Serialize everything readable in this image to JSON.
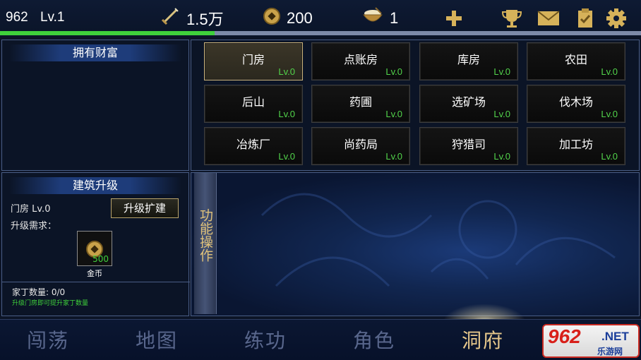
{
  "player": {
    "id": "962",
    "level": "Lv.1",
    "exp_progress": 0.335
  },
  "resources": {
    "power": "1.5万",
    "coins": "200",
    "food": "1"
  },
  "top_icons": [
    "plus-icon",
    "trophy-icon",
    "mail-icon",
    "clipboard-icon",
    "gear-icon"
  ],
  "wealth_panel": {
    "title": "拥有财富"
  },
  "buildings": [
    {
      "name": "门房",
      "level": "Lv.0",
      "selected": true
    },
    {
      "name": "点账房",
      "level": "Lv.0"
    },
    {
      "name": "库房",
      "level": "Lv.0"
    },
    {
      "name": "农田",
      "level": "Lv.0"
    },
    {
      "name": "后山",
      "level": "Lv.0"
    },
    {
      "name": "药圃",
      "level": "Lv.0"
    },
    {
      "name": "选矿场",
      "level": "Lv.0"
    },
    {
      "name": "伐木场",
      "level": "Lv.0"
    },
    {
      "name": "冶炼厂",
      "level": "Lv.0"
    },
    {
      "name": "尚药局",
      "level": "Lv.0"
    },
    {
      "name": "狩猎司",
      "level": "Lv.0"
    },
    {
      "name": "加工坊",
      "level": "Lv.0"
    }
  ],
  "upgrade_panel": {
    "title": "建筑升级",
    "current": "门房 Lv.0",
    "button": "升级扩建",
    "requirement_label": "升级需求：",
    "requirement_item": {
      "name": "金币",
      "qty": "500"
    },
    "family_count": "家丁数量: 0/0",
    "family_hint": "升级门房即可提升家丁数量"
  },
  "function_panel": {
    "tab_label": "功能操作"
  },
  "bottom_nav": [
    {
      "label": "闯荡",
      "active": false
    },
    {
      "label": "地图",
      "active": false
    },
    {
      "label": "练功",
      "active": false
    },
    {
      "label": "角色",
      "active": false
    },
    {
      "label": "洞府",
      "active": true
    }
  ],
  "watermark": {
    "brand": "962",
    "suffix": ".NET",
    "site": "乐游网"
  },
  "colors": {
    "level_green": "#52d44b",
    "exp_bar": "#3fd13b",
    "nav_active": "#e6c78b",
    "nav_inactive": "#59678d",
    "selected_border": "#cdb47a"
  }
}
